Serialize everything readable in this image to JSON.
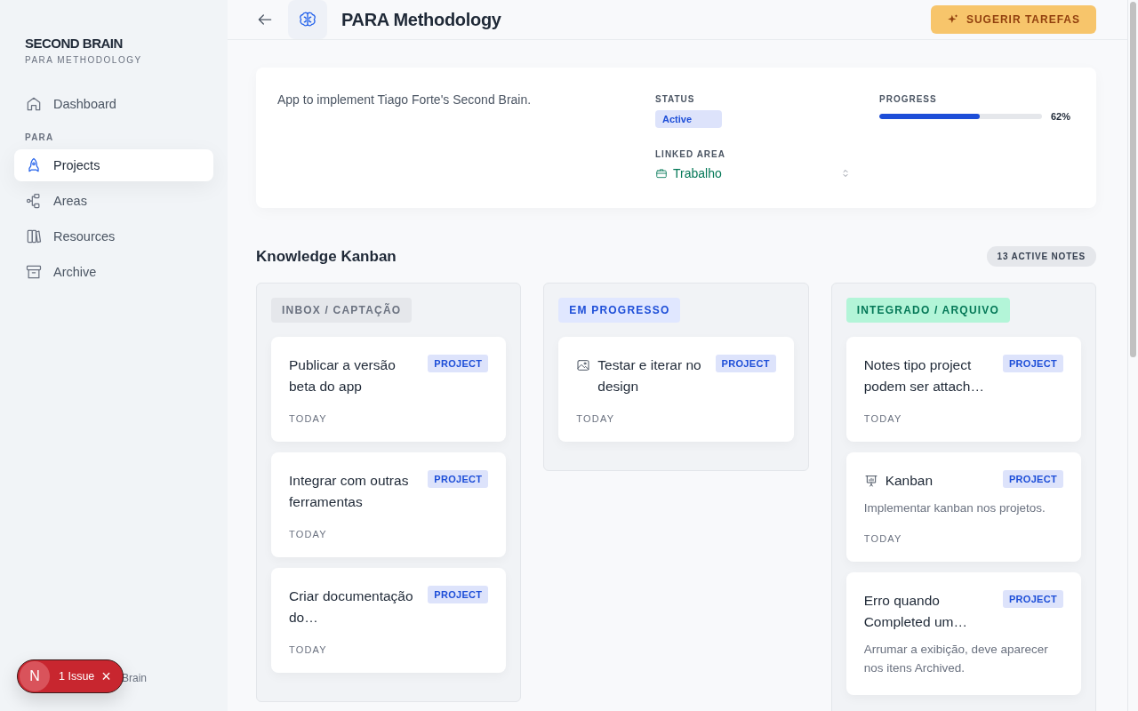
{
  "sidebar": {
    "brand": "SECOND BRAIN",
    "subtitle": "PARA METHODOLOGY",
    "nav": [
      {
        "label": "Dashboard",
        "kind": "home",
        "selected": false
      }
    ],
    "section_label": "PARA",
    "para_nav": [
      {
        "label": "Projects",
        "kind": "rocket",
        "selected": true
      },
      {
        "label": "Areas",
        "kind": "nodes",
        "selected": false
      },
      {
        "label": "Resources",
        "kind": "books",
        "selected": false
      },
      {
        "label": "Archive",
        "kind": "archive",
        "selected": false
      }
    ],
    "footer_text": "Brain"
  },
  "issue_badge": {
    "logo": "N",
    "label": "1 Issue",
    "close": "×"
  },
  "header": {
    "title": "PARA Methodology",
    "action": "SUGERIR TAREFAS"
  },
  "project": {
    "description": "App to implement Tiago Forte's Second Brain.",
    "status_label": "STATUS",
    "status": "Active",
    "linked_area_label": "LINKED AREA",
    "linked_area": "Trabalho",
    "progress_label": "PROGRESS",
    "level": 0.62,
    "progress_text": "62%"
  },
  "kanban": {
    "title": "Knowledge Kanban",
    "count": "13 ACTIVE NOTES",
    "columns": [
      {
        "title": "INBOX / CAPTAÇÃO",
        "color": "#e5e7eb",
        "cards": [
          {
            "title": "Publicar a versão beta do app",
            "tag": "PROJECT",
            "date": "TODAY"
          },
          {
            "title": "Integrar com outras ferramentas",
            "tag": "PROJECT",
            "date": "TODAY"
          },
          {
            "title": "Criar documentação do…",
            "tag": "PROJECT",
            "date": "TODAY"
          }
        ]
      },
      {
        "title": "EM PROGRESSO",
        "color": "#e0e7ff",
        "cards": [
          {
            "title": "Testar e iterar no design",
            "kind": "image",
            "tag": "PROJECT",
            "date": "TODAY"
          }
        ]
      },
      {
        "title": "INTEGRADO / ARQUIVO",
        "color": "#b3f5d8",
        "cards": [
          {
            "title": "Notes tipo project podem ser attach…",
            "tag": "PROJECT",
            "date": "TODAY"
          },
          {
            "title": "Kanban",
            "kind": "presentation",
            "tag": "PROJECT",
            "description": "Implementar kanban nos projetos.",
            "date": "TODAY"
          },
          {
            "title": "Erro quando Completed um…",
            "tag": "PROJECT",
            "description": "Arrumar a exibição, deve aparecer nos itens Archived."
          }
        ]
      }
    ]
  }
}
